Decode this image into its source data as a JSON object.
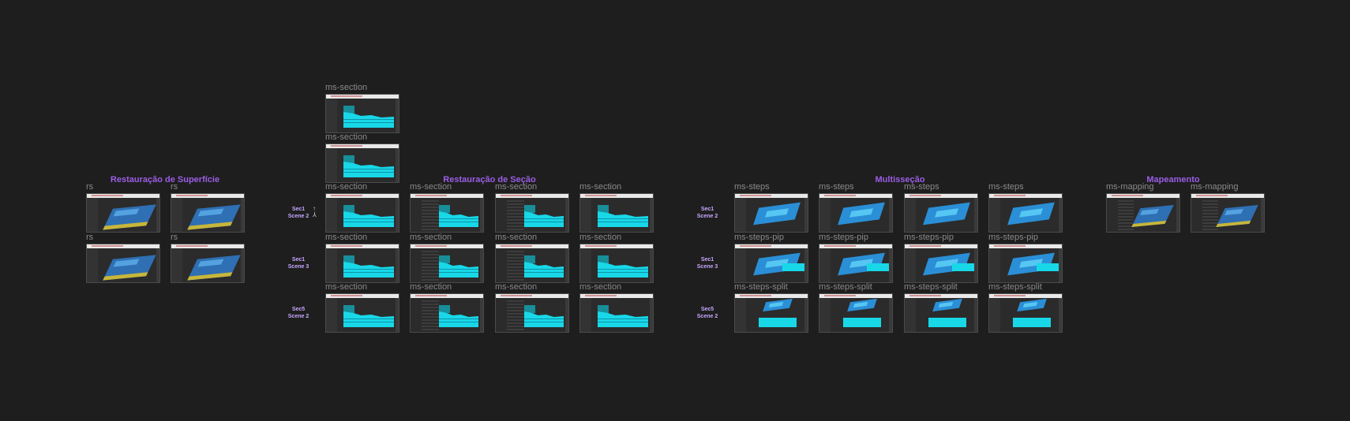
{
  "sections": {
    "superficie": "Restauração de Superfície",
    "secao": "Restauração de Seção",
    "multissecao": "Multisseção",
    "mapeamento": "Mapeamento"
  },
  "frame_labels": {
    "rs": "rs",
    "ms_section": "ms-section",
    "ms_steps": "ms-steps",
    "ms_steps_pip": "ms-steps-pip",
    "ms_steps_split": "ms-steps-split",
    "ms_mapping": "ms-mapping"
  },
  "row_labels": {
    "sec1": "Sec1",
    "sec5": "Sec5",
    "scene2": "Scene 2",
    "scene3": "Scene 3"
  },
  "colors": {
    "background": "#1e1e1e",
    "section_title": "#9b5de5",
    "row_label": "#c7a6ff",
    "frame_label": "#8a8a8a"
  }
}
